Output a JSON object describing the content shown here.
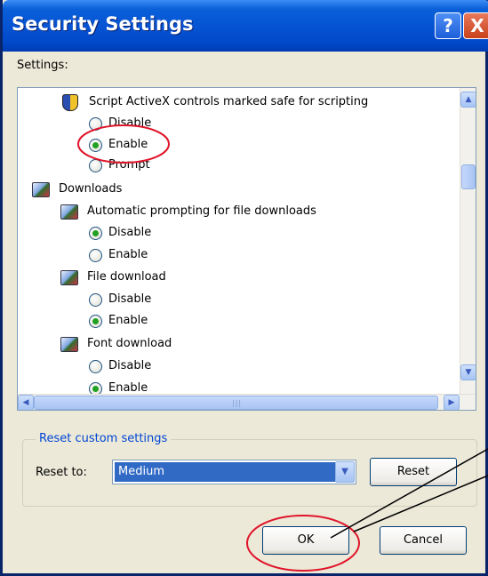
{
  "window": {
    "title": "Security Settings",
    "help_symbol": "?",
    "close_symbol": "X"
  },
  "settings_label": "Settings:",
  "settings_tree": {
    "script_activex": {
      "label": "Script ActiveX controls marked safe for scripting",
      "options": [
        "Disable",
        "Enable",
        "Prompt"
      ],
      "selected": "Enable"
    },
    "downloads": {
      "label": "Downloads",
      "auto_prompt": {
        "label": "Automatic prompting for file downloads",
        "options": [
          "Disable",
          "Enable"
        ],
        "selected": "Disable"
      },
      "file_download": {
        "label": "File download",
        "options": [
          "Disable",
          "Enable"
        ],
        "selected": "Enable"
      },
      "font_download": {
        "label": "Font download",
        "options": [
          "Disable",
          "Enable"
        ],
        "selected": "Enable"
      }
    }
  },
  "reset_group": {
    "title": "Reset custom settings",
    "reset_to_label": "Reset to:",
    "reset_to_value": "Medium",
    "reset_button": "Reset"
  },
  "buttons": {
    "ok": "OK",
    "cancel": "Cancel"
  },
  "colors": {
    "titlebar": "#0654d4",
    "dialog_bg": "#ece9d8",
    "radio_check": "#21a121",
    "selection": "#316ac5",
    "annotation": "#e0142a"
  }
}
